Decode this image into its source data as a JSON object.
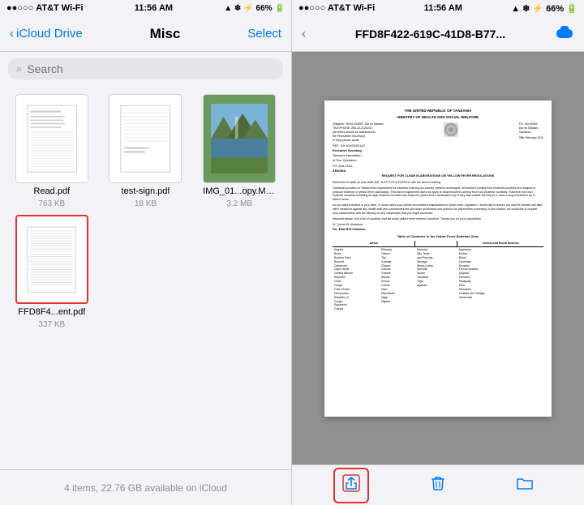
{
  "left": {
    "status_bar": {
      "signal": "●●○○○",
      "carrier": "AT&T Wi-Fi",
      "time": "11:56 AM",
      "battery": "66%",
      "icons": "▲ ❄ ⚡"
    },
    "nav": {
      "back_label": "iCloud Drive",
      "title": "Misc",
      "action_label": "Select"
    },
    "search": {
      "placeholder": "Search"
    },
    "files": [
      {
        "name": "Read.pdf",
        "size": "763 KB",
        "selected": false,
        "type": "pdf"
      },
      {
        "name": "test-sign.pdf",
        "size": "18 KB",
        "selected": false,
        "type": "pdf"
      },
      {
        "name": "IMG_01...opy.MOV",
        "size": "3.2 MB",
        "selected": false,
        "type": "mov"
      },
      {
        "name": "FFD8F4...ent.pdf",
        "size": "337 KB",
        "selected": true,
        "type": "pdf"
      }
    ],
    "footer": "4 items, 22.76 GB available on iCloud"
  },
  "right": {
    "status_bar": {
      "signal": "●●○○○",
      "carrier": "AT&T Wi-Fi",
      "time": "11:56 AM",
      "battery": "66%"
    },
    "nav": {
      "title": "FFD8F422-619C-41D8-B77..."
    },
    "pdf": {
      "header_line1": "THE UNITED REPUBLIC OF TANZANIA",
      "header_line2": "MINISTRY OF HEALTH AND SOCIAL WELFARE",
      "ref": "REF: GA.209/333/01/47",
      "date": "28th February 2011",
      "subject": "ARUSHA",
      "title": "REQUEST FOR CLEAR ELABORATIONS ON YELLOW FEVER REGULATIONS",
      "body": "Reference is made on your letter Ref. M.07/7175 of 10/2/2011 with the above heading.",
      "table_title": "Table of Countries in the Yellow Fever-Endemic Zone",
      "table_headers": [
        "Africa",
        "",
        "Central and South America"
      ],
      "africa_col1": [
        "Angola",
        "Benin",
        "Burkina Faso",
        "Burundi",
        "Cameroon",
        "Cape Verde",
        "Central African Republic",
        "Chad",
        "Congo",
        "Côte d'Ivoire",
        "Democratic Republic of Congo",
        "Equatorial Guinea"
      ],
      "africa_col2": [
        "Ethiopia",
        "Gabon",
        "The Gambia",
        "Ghana",
        "Guinea",
        "Guinea Bissau",
        "Kenya",
        "Liberia",
        "Mali",
        "Mauritania",
        "Niger",
        "Nigeria"
      ],
      "africa_col3": [
        "Rwanda",
        "São Tomé and Príncipe",
        "Senegal",
        "Sierra Leone",
        "Somalia",
        "Sudan",
        "Tanzania",
        "Togo",
        "Uganda"
      ],
      "central_south": [
        "Argentina",
        "Bolivia",
        "Brazil",
        "Colombia",
        "Ecuador",
        "French Guiana",
        "Guyana",
        "Panama",
        "Paraguay",
        "Peru",
        "Suriname",
        "Trinidad and Tobago",
        "Venezuela"
      ]
    },
    "toolbar": {
      "share_label": "Share",
      "delete_label": "Delete",
      "folder_label": "Folder"
    }
  }
}
